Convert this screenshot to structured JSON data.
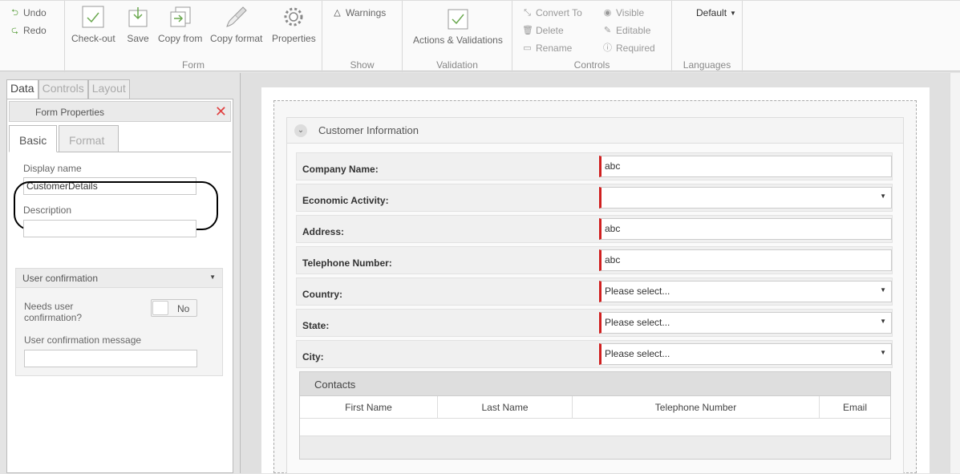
{
  "ribbon": {
    "undo": "Undo",
    "redo": "Redo",
    "form_group": {
      "label": "Form",
      "buttons": [
        "Check-out",
        "Save",
        "Copy from",
        "Copy format",
        "Properties"
      ]
    },
    "show_group": {
      "label": "Show",
      "warnings": "Warnings"
    },
    "validation_group": {
      "label": "Validation",
      "actions": "Actions & Validations"
    },
    "controls_group": {
      "label": "Controls",
      "convert_to": "Convert To",
      "delete": "Delete",
      "rename": "Rename",
      "visible": "Visible",
      "editable": "Editable",
      "required": "Required"
    },
    "languages_group": {
      "label": "Languages",
      "selected": "Default"
    }
  },
  "left_tabs": [
    "Data",
    "Controls",
    "Layout"
  ],
  "form_properties": {
    "title": "Form Properties",
    "subtabs": [
      "Basic",
      "Format"
    ],
    "display_name_label": "Display name",
    "display_name_value": "CustomerDetails",
    "description_label": "Description",
    "description_value": "",
    "user_confirmation": {
      "title": "User confirmation",
      "needs_label_1": "Needs user",
      "needs_label_2": "confirmation?",
      "toggle_value": "No",
      "message_label": "User confirmation message",
      "message_value": ""
    }
  },
  "canvas": {
    "section_title": "Customer Information",
    "fields": [
      {
        "label": "Company Name:",
        "value": "abc",
        "dropdown": false
      },
      {
        "label": "Economic Activity:",
        "value": "",
        "dropdown": true
      },
      {
        "label": "Address:",
        "value": "abc",
        "dropdown": false
      },
      {
        "label": "Telephone Number:",
        "value": "abc",
        "dropdown": false
      },
      {
        "label": "Country:",
        "value": "Please select...",
        "dropdown": true
      },
      {
        "label": "State:",
        "value": "Please select...",
        "dropdown": true
      },
      {
        "label": "City:",
        "value": "Please select...",
        "dropdown": true
      }
    ],
    "contacts": {
      "title": "Contacts",
      "columns": [
        "First Name",
        "Last Name",
        "Telephone Number",
        "Email"
      ]
    }
  },
  "colors": {
    "required_marker": "#d02020",
    "accent_green": "#6aa84f"
  }
}
